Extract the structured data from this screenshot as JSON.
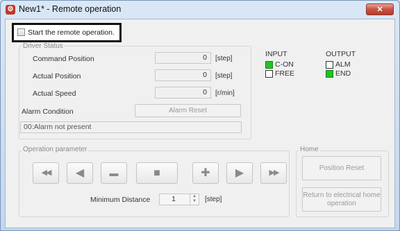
{
  "window": {
    "title": "New1* - Remote operation",
    "close_label": "✕"
  },
  "remote": {
    "checkbox_label": "Start the remote operation.",
    "checked": false
  },
  "driver_status": {
    "group_title": "Driver Status",
    "command_position": {
      "label": "Command Position",
      "value": "0",
      "unit": "[step]"
    },
    "actual_position": {
      "label": "Actual Position",
      "value": "0",
      "unit": "[step]"
    },
    "actual_speed": {
      "label": "Actual Speed",
      "value": "0",
      "unit": "[r/min]"
    },
    "alarm_condition_label": "Alarm Condition",
    "alarm_reset_label": "Alarm Reset",
    "alarm_text": "00:Alarm not present"
  },
  "io": {
    "input_title": "INPUT",
    "output_title": "OUTPUT",
    "inputs": [
      {
        "label": "C-ON",
        "state": "on"
      },
      {
        "label": "FREE",
        "state": "off"
      }
    ],
    "outputs": [
      {
        "label": "ALM",
        "state": "off"
      },
      {
        "label": "END",
        "state": "on"
      }
    ],
    "on_color": "#22c322"
  },
  "operation": {
    "group_title": "Operation parameter",
    "buttons": [
      {
        "name": "fast-reverse-button",
        "icon": "fast-rewind-icon",
        "glyph": "◀◀"
      },
      {
        "name": "reverse-button",
        "icon": "play-left-icon",
        "glyph": "◀"
      },
      {
        "name": "minus-button",
        "icon": "minus-icon",
        "glyph": "▬"
      },
      {
        "name": "stop-button",
        "icon": "stop-icon",
        "glyph": "■"
      },
      {
        "name": "plus-button",
        "icon": "plus-icon",
        "glyph": "✚"
      },
      {
        "name": "forward-button",
        "icon": "play-right-icon",
        "glyph": "▶"
      },
      {
        "name": "fast-forward-button",
        "icon": "fast-forward-icon",
        "glyph": "▶▶"
      }
    ],
    "min_distance_label": "Minimum Distance",
    "min_distance_value": "1",
    "min_distance_unit": "[step]"
  },
  "home": {
    "group_title": "Home",
    "position_reset_label": "Position Reset",
    "return_label": "Return to electrical home operation"
  }
}
